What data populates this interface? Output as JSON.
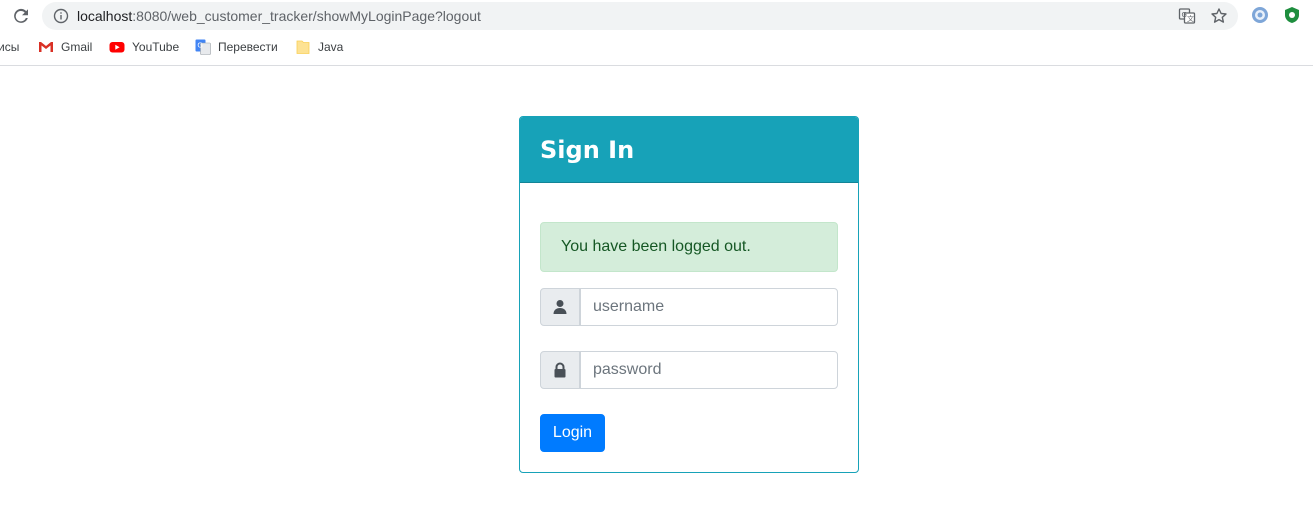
{
  "browser": {
    "url_host": "localhost",
    "url_rest": ":8080/web_customer_tracker/showMyLoginPage?logout",
    "bookmarks": [
      {
        "label": "исы",
        "icon": "apps-icon"
      },
      {
        "label": "Gmail",
        "icon": "gmail-icon"
      },
      {
        "label": "YouTube",
        "icon": "youtube-icon"
      },
      {
        "label": "Перевести",
        "icon": "google-translate-icon"
      },
      {
        "label": "Java",
        "icon": "folder-icon"
      }
    ]
  },
  "login": {
    "title": "Sign In",
    "alert": "You have been logged out.",
    "username_placeholder": "username",
    "password_placeholder": "password",
    "login_label": "Login"
  },
  "colors": {
    "header": "#17a2b8",
    "alert_bg": "#d4edda",
    "alert_text": "#155724",
    "button": "#007bff"
  }
}
